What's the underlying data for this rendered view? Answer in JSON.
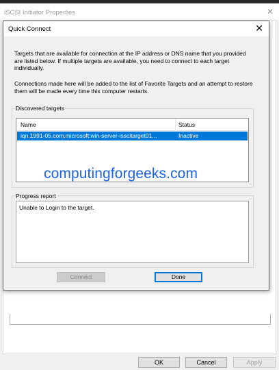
{
  "parent_window": {
    "title": "iSCSI Initiator Properties",
    "buttons": {
      "ok": "OK",
      "cancel": "Cancel",
      "apply": "Apply"
    }
  },
  "dialog": {
    "title": "Quick Connect",
    "instruction_1": "Targets that are available for connection at the IP address or DNS name that you provided are listed below.  If multiple targets are available, you need to connect to each target individually.",
    "instruction_2": "Connections made here will be added to the list of Favorite Targets and an attempt to restore them will be made every time this computer restarts.",
    "discovered_targets": {
      "label": "Discovered targets",
      "columns": [
        "Name",
        "Status"
      ],
      "rows": [
        {
          "name": "iqn.1991-05.com.microsoft:win-server-isscitarget01...",
          "status": "Inactive",
          "selected": true
        }
      ]
    },
    "progress_report": {
      "label": "Progress report",
      "text": "Unable to Login to the target."
    },
    "buttons": {
      "connect": "Connect",
      "done": "Done"
    }
  },
  "watermark": "computingforgeeks.com",
  "colors": {
    "selection": "#0078d7",
    "watermark": "#1a62e6",
    "dialog_background": "#f0f0f0"
  }
}
